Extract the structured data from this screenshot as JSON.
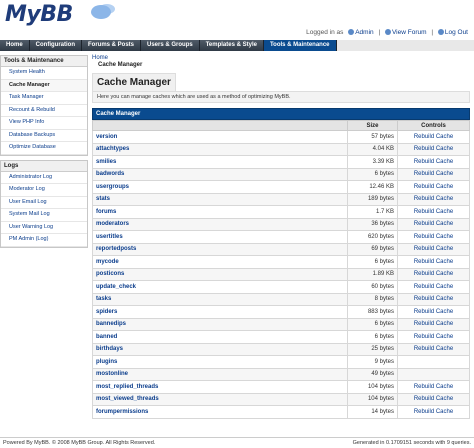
{
  "logo": {
    "text": "MyBB"
  },
  "userbar": {
    "logged_in_as": "Logged in as",
    "user": "Admin",
    "view_forum": "View Forum",
    "logout": "Log Out"
  },
  "nav": {
    "items": [
      {
        "label": "Home"
      },
      {
        "label": "Configuration"
      },
      {
        "label": "Forums & Posts"
      },
      {
        "label": "Users & Groups"
      },
      {
        "label": "Templates & Style"
      },
      {
        "label": "Tools & Maintenance"
      }
    ],
    "active_index": 5
  },
  "sidebar": {
    "sections": [
      {
        "title": "Tools & Maintenance",
        "items": [
          "System Health",
          "Cache Manager",
          "Task Manager",
          "Recount & Rebuild",
          "View PHP Info",
          "Database Backups",
          "Optimize Database"
        ],
        "active": "Cache Manager"
      },
      {
        "title": "Logs",
        "items": [
          "Administrator Log",
          "Moderator Log",
          "User Email Log",
          "System Mail Log",
          "User Warning Log",
          "PM Admin (Log)"
        ],
        "active": ""
      }
    ]
  },
  "breadcrumb": {
    "home": "Home",
    "current": "Cache Manager"
  },
  "main": {
    "title": "Cache Manager",
    "description": "Here you can manage caches which are used as a method of optimizing MyBB."
  },
  "table": {
    "caption": "Cache Manager",
    "headers": {
      "name": "",
      "size": "Size",
      "controls": "Controls"
    },
    "rows": [
      {
        "name": "version",
        "size": "57 bytes",
        "control": "Rebuild Cache"
      },
      {
        "name": "attachtypes",
        "size": "4.04 KB",
        "control": "Rebuild Cache"
      },
      {
        "name": "smilies",
        "size": "3.39 KB",
        "control": "Rebuild Cache"
      },
      {
        "name": "badwords",
        "size": "6 bytes",
        "control": "Rebuild Cache"
      },
      {
        "name": "usergroups",
        "size": "12.46 KB",
        "control": "Rebuild Cache"
      },
      {
        "name": "stats",
        "size": "189 bytes",
        "control": "Rebuild Cache"
      },
      {
        "name": "forums",
        "size": "1.7 KB",
        "control": "Rebuild Cache"
      },
      {
        "name": "moderators",
        "size": "36 bytes",
        "control": "Rebuild Cache"
      },
      {
        "name": "usertitles",
        "size": "620 bytes",
        "control": "Rebuild Cache"
      },
      {
        "name": "reportedposts",
        "size": "69 bytes",
        "control": "Rebuild Cache"
      },
      {
        "name": "mycode",
        "size": "6 bytes",
        "control": "Rebuild Cache"
      },
      {
        "name": "posticons",
        "size": "1.89 KB",
        "control": "Rebuild Cache"
      },
      {
        "name": "update_check",
        "size": "60 bytes",
        "control": "Rebuild Cache"
      },
      {
        "name": "tasks",
        "size": "8 bytes",
        "control": "Rebuild Cache"
      },
      {
        "name": "spiders",
        "size": "883 bytes",
        "control": "Rebuild Cache"
      },
      {
        "name": "bannedips",
        "size": "6 bytes",
        "control": "Rebuild Cache"
      },
      {
        "name": "banned",
        "size": "6 bytes",
        "control": "Rebuild Cache"
      },
      {
        "name": "birthdays",
        "size": "25 bytes",
        "control": "Rebuild Cache"
      },
      {
        "name": "plugins",
        "size": "9 bytes",
        "control": ""
      },
      {
        "name": "mostonline",
        "size": "49 bytes",
        "control": ""
      },
      {
        "name": "most_replied_threads",
        "size": "104 bytes",
        "control": "Rebuild Cache"
      },
      {
        "name": "most_viewed_threads",
        "size": "104 bytes",
        "control": "Rebuild Cache"
      },
      {
        "name": "forumpermissions",
        "size": "14 bytes",
        "control": "Rebuild Cache"
      }
    ]
  },
  "footer": {
    "left": "Powered By MyBB. © 2008 MyBB Group. All Rights Reserved.",
    "right": "Generated in 0.1709151 seconds with 9 queries."
  },
  "colors": {
    "accent": "#0a4b8f",
    "nav_dark": "#2f3945",
    "link": "#0b3d8c"
  }
}
